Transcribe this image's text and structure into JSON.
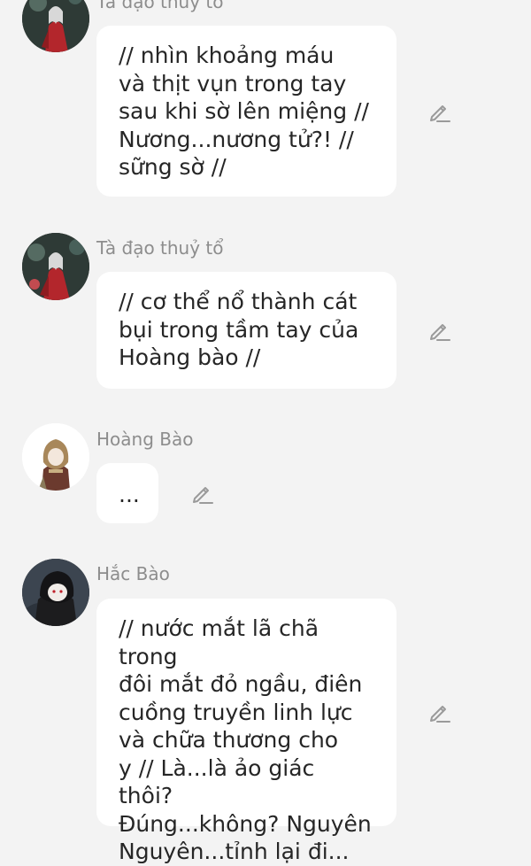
{
  "messages": [
    {
      "sender": "Tà đạo thuỷ tổ",
      "text": "// nhìn khoảng máu\nvà thịt vụn trong tay\nsau khi sờ lên miệng //\nNương...nương tử?! //\nsững sờ //",
      "avatar_icon": "red-robed-figure-avatar"
    },
    {
      "sender": "Tà đạo thuỷ tổ",
      "text": "// cơ thể nổ thành cát\nbụi trong tầm tay của\nHoàng bào //",
      "avatar_icon": "red-robed-figure-avatar"
    },
    {
      "sender": "Hoàng Bào",
      "text": "...",
      "avatar_icon": "hooded-brown-figure-avatar"
    },
    {
      "sender": "Hắc Bào",
      "text": "// nước mắt lã chã trong\nđôi mắt đỏ ngầu, điên\ncuồng truyền linh lực\nvà chữa thương cho\ny // Là...là ảo giác thôi?\nĐúng...không? Nguyên\nNguyên...tỉnh lại đi...",
      "avatar_icon": "black-hooded-figure-avatar"
    }
  ],
  "edit_icon": "pencil-edit-icon",
  "colors": {
    "background": "#f3f3f3",
    "bubble": "#ffffff",
    "text": "#262626",
    "name": "#8d8d8d",
    "icon": "#9a9a9a"
  }
}
